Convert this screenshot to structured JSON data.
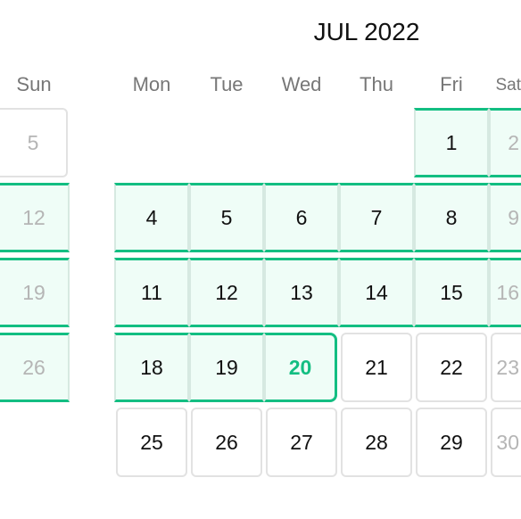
{
  "calendar": {
    "title": "JUL 2022",
    "weekdays": [
      "Sun",
      "Mon",
      "Tue",
      "Wed",
      "Thu",
      "Fri",
      "Sat"
    ],
    "accent_color": "#13be82",
    "selected_date": "20",
    "weeks": [
      [
        {
          "d": "5",
          "muted": true
        },
        null,
        null,
        null,
        null,
        {
          "d": "1",
          "range": true
        },
        {
          "d": "2",
          "muted": true,
          "range": true
        }
      ],
      [
        {
          "d": "12",
          "muted": true,
          "range": true
        },
        {
          "d": "4",
          "range": true
        },
        {
          "d": "5",
          "range": true
        },
        {
          "d": "6",
          "range": true
        },
        {
          "d": "7",
          "range": true
        },
        {
          "d": "8",
          "range": true
        },
        {
          "d": "9",
          "muted": true,
          "range": true
        }
      ],
      [
        {
          "d": "19",
          "muted": true,
          "range": true
        },
        {
          "d": "11",
          "range": true
        },
        {
          "d": "12",
          "range": true
        },
        {
          "d": "13",
          "range": true
        },
        {
          "d": "14",
          "range": true
        },
        {
          "d": "15",
          "range": true
        },
        {
          "d": "16",
          "muted": true,
          "range": true
        }
      ],
      [
        {
          "d": "26",
          "muted": true,
          "range": true
        },
        {
          "d": "18",
          "range": true
        },
        {
          "d": "19",
          "range": true
        },
        {
          "d": "20",
          "range": true,
          "end": true,
          "selected": true
        },
        {
          "d": "21"
        },
        {
          "d": "22"
        },
        {
          "d": "23",
          "muted": true
        }
      ],
      [
        null,
        {
          "d": "25"
        },
        {
          "d": "26"
        },
        {
          "d": "27"
        },
        {
          "d": "28"
        },
        {
          "d": "29"
        },
        {
          "d": "30",
          "muted": true
        }
      ]
    ]
  }
}
